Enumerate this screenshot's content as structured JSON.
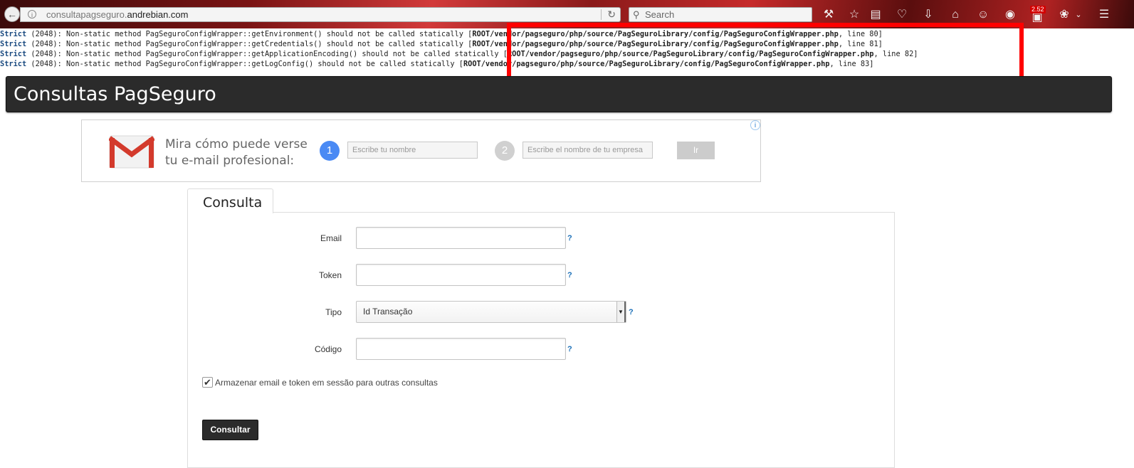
{
  "browser": {
    "url_prefix": "consultapagseguro.",
    "url_host": "andrebian.com",
    "search_placeholder": "Search",
    "badge": "2.52"
  },
  "notices": [
    {
      "kind": "Strict",
      "code": " (2048): ",
      "message": "Non-static method PagSeguroConfigWrapper::getEnvironment() should not be called statically [",
      "path": "ROOT/vendor/pagseguro/php/source/PagSeguroLibrary/config/PagSeguroConfigWrapper.php",
      "line": ", line 80]"
    },
    {
      "kind": "Strict",
      "code": " (2048): ",
      "message": "Non-static method PagSeguroConfigWrapper::getCredentials() should not be called statically [",
      "path": "ROOT/vendor/pagseguro/php/source/PagSeguroLibrary/config/PagSeguroConfigWrapper.php",
      "line": ", line 81]"
    },
    {
      "kind": "Strict",
      "code": " (2048): ",
      "message": "Non-static method PagSeguroConfigWrapper::getApplicationEncoding() should not be called statically [",
      "path": "ROOT/vendor/pagseguro/php/source/PagSeguroLibrary/config/PagSeguroConfigWrapper.php",
      "line": ", line 82]"
    },
    {
      "kind": "Strict",
      "code": " (2048): ",
      "message": "Non-static method PagSeguroConfigWrapper::getLogConfig() should not be called statically [",
      "path": "ROOT/vendor/pagseguro/php/source/PagSeguroLibrary/config/PagSeguroConfigWrapper.php",
      "line": ", line 83]"
    }
  ],
  "header": {
    "title": "Consultas PagSeguro"
  },
  "ad": {
    "headline": "Mira cómo puede verse tu e-mail profesional:",
    "step1": "1",
    "step2": "2",
    "name_placeholder": "Escribe tu nombre",
    "company_placeholder": "Escribe el nombre de tu empresa",
    "button": "Ir",
    "adchoices": "i"
  },
  "form": {
    "tab": "Consulta",
    "email_label": "Email",
    "email_value": "",
    "token_label": "Token",
    "token_value": "",
    "tipo_label": "Tipo",
    "tipo_value": "Id Transação",
    "codigo_label": "Código",
    "codigo_value": "",
    "help": "?",
    "remember_label": "Armazenar email e token em sessão para outras consultas",
    "remember_checked": true,
    "submit": "Consultar"
  },
  "colors": {
    "header_bg": "#2b2b2b",
    "highlight": "#ff0000",
    "help_link": "#1a6fb8",
    "step_active": "#4a8af4"
  }
}
